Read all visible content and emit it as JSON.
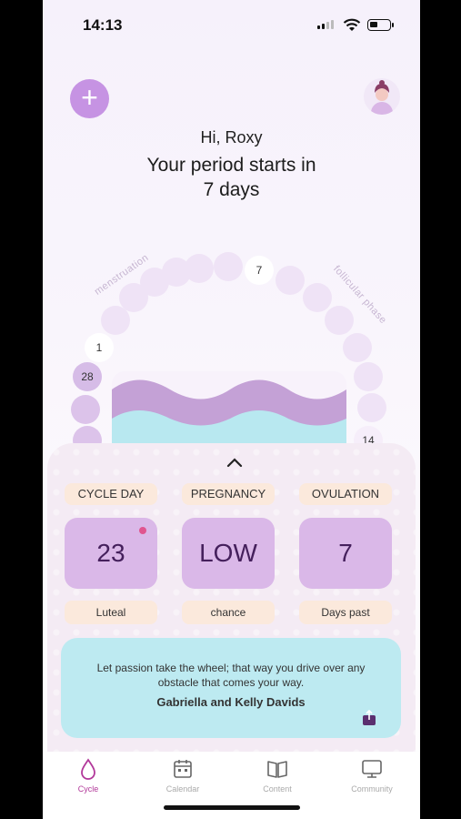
{
  "status_bar": {
    "time": "14:13"
  },
  "header": {
    "greeting": "Hi, Roxy",
    "headline_line1": "Your period starts in",
    "headline_line2": "7 days"
  },
  "cycle_ring": {
    "phase_left": "menstruation",
    "phase_right": "follicular phase",
    "day_markers": {
      "day_1": "1",
      "day_7": "7",
      "day_14": "14",
      "day_28": "28"
    }
  },
  "stats": {
    "cycle_day": {
      "label": "CYCLE DAY",
      "value": "23",
      "sub": "Luteal"
    },
    "pregnancy": {
      "label": "PREGNANCY",
      "value": "LOW",
      "sub": "chance"
    },
    "ovulation": {
      "label": "OVULATION",
      "value": "7",
      "sub": "Days past"
    }
  },
  "quote": {
    "text": "Let passion take the wheel; that way you drive over any obstacle that comes your way.",
    "author": "Gabriella and Kelly Davids"
  },
  "tabs": [
    {
      "label": "Cycle",
      "icon": "drop-icon",
      "active": true
    },
    {
      "label": "Calendar",
      "icon": "calendar-icon",
      "active": false
    },
    {
      "label": "Content",
      "icon": "book-icon",
      "active": false
    },
    {
      "label": "Community",
      "icon": "monitor-icon",
      "active": false
    }
  ],
  "colors": {
    "accent": "#c693e3",
    "card": "#dab8e8",
    "pill": "#fbe9dc",
    "quote_bg": "#bdeaf1",
    "active_tab": "#b2389a",
    "notification": "#e0558f"
  }
}
